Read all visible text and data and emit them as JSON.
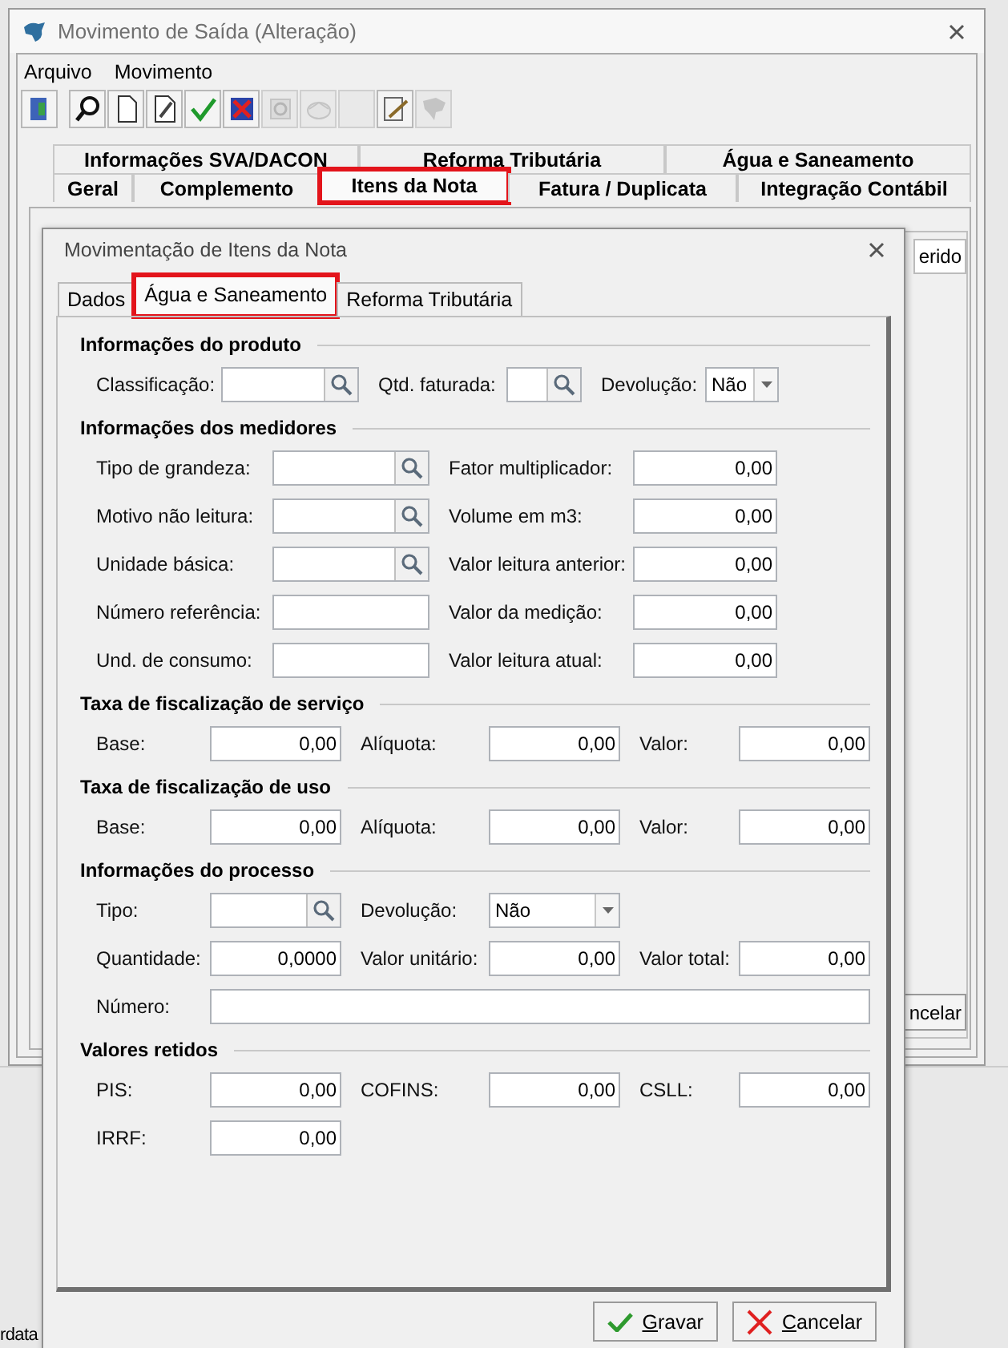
{
  "window": {
    "title": "Movimento de Saída (Alteração)",
    "menu": [
      "Arquivo",
      "Movimento"
    ],
    "toolbar": [
      {
        "disabled": false
      },
      {
        "disabled": false
      },
      {
        "disabled": false
      },
      {
        "disabled": false
      },
      {
        "disabled": false
      },
      {
        "disabled": false
      },
      {
        "disabled": true
      },
      {
        "disabled": true
      },
      {
        "disabled": true
      },
      {
        "disabled": false
      },
      {
        "disabled": true
      }
    ],
    "tabs_row1": [
      {
        "label": "Informações SVA/DACON",
        "selected": false,
        "highlighted": false
      },
      {
        "label": "Reforma Tributária",
        "selected": false,
        "highlighted": false
      },
      {
        "label": "Água e Saneamento",
        "selected": false,
        "highlighted": false
      }
    ],
    "tabs_row2": [
      {
        "label": "Geral",
        "selected": false,
        "highlighted": false
      },
      {
        "label": "Complemento",
        "selected": false,
        "highlighted": false
      },
      {
        "label": "Itens da Nota",
        "selected": true,
        "highlighted": true
      },
      {
        "label": "Fatura / Duplicata",
        "selected": false,
        "highlighted": false
      },
      {
        "label": "Integração Contábil",
        "selected": false,
        "highlighted": false
      }
    ],
    "inner_tab": "erido",
    "inner_button": "ncelar"
  },
  "status_text": "rdata",
  "dialog": {
    "title": "Movimentação de Itens da Nota",
    "tabs": [
      {
        "label": "Dados",
        "selected": false,
        "highlighted": false
      },
      {
        "label": "Água e Saneamento",
        "selected": true,
        "highlighted": true
      },
      {
        "label": "Reforma Tributária",
        "selected": false,
        "highlighted": false
      }
    ],
    "sections": [
      {
        "title": "Informações do produto",
        "rows": [
          [
            {
              "label": "Classificação:",
              "kind": "lookup"
            },
            {
              "label": "Qtd. faturada:",
              "kind": "lookup"
            },
            {
              "label": "Devolução:",
              "kind": "combo",
              "value": "Não"
            }
          ]
        ]
      },
      {
        "title": "Informações dos medidores",
        "rows": [
          [
            {
              "label": "Tipo de grandeza:",
              "kind": "lookup"
            },
            {
              "label": "Fator multiplicador:",
              "kind": "number",
              "value": "0,00"
            }
          ],
          [
            {
              "label": "Motivo não leitura:",
              "kind": "lookup"
            },
            {
              "label": "Volume em m3:",
              "kind": "number",
              "value": "0,00"
            }
          ],
          [
            {
              "label": "Unidade básica:",
              "kind": "lookup"
            },
            {
              "label": "Valor leitura anterior:",
              "kind": "number",
              "value": "0,00"
            }
          ],
          [
            {
              "label": "Número referência:",
              "kind": "text"
            },
            {
              "label": "Valor da medição:",
              "kind": "number",
              "value": "0,00"
            }
          ],
          [
            {
              "label": "Und. de consumo:",
              "kind": "text"
            },
            {
              "label": "Valor leitura atual:",
              "kind": "number",
              "value": "0,00"
            }
          ]
        ]
      },
      {
        "title": "Taxa de fiscalização de serviço",
        "rows": [
          [
            {
              "label": "Base:",
              "kind": "number",
              "value": "0,00"
            },
            {
              "label": "Alíquota:",
              "kind": "number",
              "value": "0,00"
            },
            {
              "label": "Valor:",
              "kind": "number",
              "value": "0,00"
            }
          ]
        ]
      },
      {
        "title": "Taxa de fiscalização de uso",
        "rows": [
          [
            {
              "label": "Base:",
              "kind": "number",
              "value": "0,00"
            },
            {
              "label": "Alíquota:",
              "kind": "number",
              "value": "0,00"
            },
            {
              "label": "Valor:",
              "kind": "number",
              "value": "0,00"
            }
          ]
        ]
      },
      {
        "title": "Informações do processo",
        "rows": [
          [
            {
              "label": "Tipo:",
              "kind": "lookup"
            },
            {
              "label": "Devolução:",
              "kind": "combo",
              "value": "Não"
            }
          ],
          [
            {
              "label": "Quantidade:",
              "kind": "number",
              "value": "0,0000"
            },
            {
              "label": "Valor unitário:",
              "kind": "number",
              "value": "0,00"
            },
            {
              "label": "Valor total:",
              "kind": "number",
              "value": "0,00"
            }
          ],
          [
            {
              "label": "Número:",
              "kind": "wide"
            }
          ]
        ]
      },
      {
        "title": "Valores retidos",
        "rows": [
          [
            {
              "label": "PIS:",
              "kind": "number",
              "value": "0,00"
            },
            {
              "label": "COFINS:",
              "kind": "number",
              "value": "0,00"
            },
            {
              "label": "CSLL:",
              "kind": "number",
              "value": "0,00"
            }
          ],
          [
            {
              "label": "IRRF:",
              "kind": "number",
              "value": "0,00"
            }
          ]
        ]
      }
    ],
    "buttons": [
      {
        "label": "Gravar",
        "kind": "save"
      },
      {
        "label": "Cancelar",
        "kind": "cancel"
      }
    ]
  }
}
